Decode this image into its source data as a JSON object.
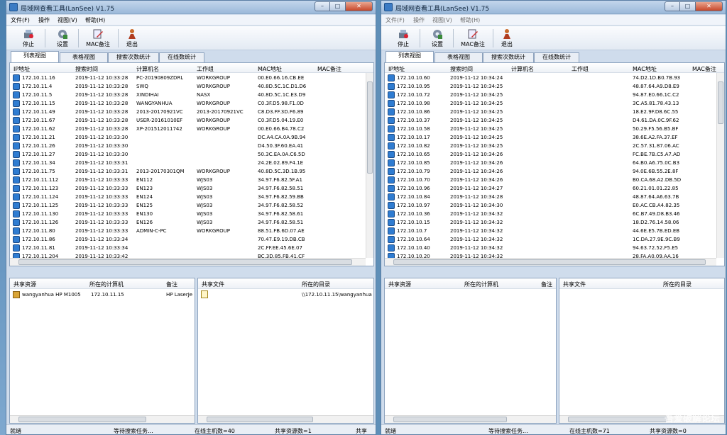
{
  "title": "局域网查看工具(LanSee) V1.75",
  "menu": [
    "文件(F)",
    "操作",
    "视图(V)",
    "帮助(H)"
  ],
  "window_buttons": {
    "min": "–",
    "max": "□",
    "close": "✕"
  },
  "toolbar": {
    "stop": "停止",
    "settings": "设置",
    "mac_note": "MAC备注",
    "exit": "退出"
  },
  "tabs": [
    "列表视图",
    "表格视图",
    "搜索次数统计",
    "在线数统计"
  ],
  "columns": [
    "IP地址",
    "搜索时间",
    "计算机名",
    "工作组",
    "MAC地址",
    "MAC备注"
  ],
  "left_rows": [
    [
      "172.10.11.16",
      "2019-11-12 10:33:28",
      "PC-20190809ZDRL",
      "WORKGROUP",
      "00.E0.66.16.CB.EE"
    ],
    [
      "172.10.11.4",
      "2019-11-12 10:33:28",
      "SWQ",
      "WORKGROUP",
      "40.8D.5C.1C.D1.D6"
    ],
    [
      "172.10.11.5",
      "2019-11-12 10:33:28",
      "XINDIHAI",
      "NASX",
      "40.8D.5C.1C.E3.D9"
    ],
    [
      "172.10.11.15",
      "2019-11-12 10:33:28",
      "WANGYANHUA",
      "WORKGROUP",
      "C0.3F.D5.98.F1.0D"
    ],
    [
      "172.10.11.49",
      "2019-11-12 10:33:28",
      "2013-20170921VC",
      "2013-20170921VC",
      "C8.D3.FF.3D.F6.89"
    ],
    [
      "172.10.11.67",
      "2019-11-12 10:33:28",
      "USER-20161010EF",
      "WORKGROUP",
      "C0.3F.D5.04.19.E0"
    ],
    [
      "172.10.11.62",
      "2019-11-12 10:33:28",
      "XP-201512011742",
      "WORKGROUP",
      "00.E0.66.B4.78.C2"
    ],
    [
      "172.10.11.21",
      "2019-11-12 10:33:30",
      "",
      "",
      "DC.A4.CA.0A.9B.94"
    ],
    [
      "172.10.11.26",
      "2019-11-12 10:33:30",
      "",
      "",
      "D4.50.3F.60.EA.41"
    ],
    [
      "172.10.11.27",
      "2019-11-12 10:33:30",
      "",
      "",
      "50.3C.EA.0A.C6.5D"
    ],
    [
      "172.10.11.34",
      "2019-11-12 10:33:31",
      "",
      "",
      "24.2E.02.89.F4.1E"
    ],
    [
      "172.10.11.75",
      "2019-11-12 10:33:31",
      "2013-20170301QM",
      "WORKGROUP",
      "40.8D.5C.3D.1B.95"
    ],
    [
      "172.10.11.112",
      "2019-11-12 10:33:33",
      "EN112",
      "WJS03",
      "34.97.F6.82.5F.A1"
    ],
    [
      "172.10.11.123",
      "2019-11-12 10:33:33",
      "EN123",
      "WJS03",
      "34.97.F6.82.58.51"
    ],
    [
      "172.10.11.124",
      "2019-11-12 10:33:33",
      "EN124",
      "WJS03",
      "34.97.F6.82.59.BB"
    ],
    [
      "172.10.11.125",
      "2019-11-12 10:33:33",
      "EN125",
      "WJS03",
      "34.97.F6.82.58.52"
    ],
    [
      "172.10.11.130",
      "2019-11-12 10:33:33",
      "EN130",
      "WJS03",
      "34.97.F6.82.58.61"
    ],
    [
      "172.10.11.126",
      "2019-11-12 10:33:33",
      "EN126",
      "WJS03",
      "34.97.F6.82.58.51"
    ],
    [
      "172.10.11.80",
      "2019-11-12 10:33:33",
      "ADMIN-C-PC",
      "WORKGROUP",
      "88.51.FB.6D.07.AE"
    ],
    [
      "172.10.11.86",
      "2019-11-12 10:33:34",
      "",
      "",
      "70.47.E9.19.DB.CB"
    ],
    [
      "172.10.11.81",
      "2019-11-12 10:33:34",
      "",
      "",
      "2C.FF.EE.45.6E.07"
    ],
    [
      "172.10.11.204",
      "2019-11-12 10:33:42",
      "",
      "",
      "BC.3D.85.FB.41.CF"
    ]
  ],
  "right_rows": [
    [
      "172.10.10.60",
      "2019-11-12 10:34:24",
      "",
      "",
      "74.D2.1D.B0.7B.93"
    ],
    [
      "172.10.10.95",
      "2019-11-12 10:34:25",
      "",
      "",
      "48.87.64.A9.D8.E9"
    ],
    [
      "172.10.10.72",
      "2019-11-12 10:34:25",
      "",
      "",
      "94.87.E0.66.1C.C2"
    ],
    [
      "172.10.10.98",
      "2019-11-12 10:34:25",
      "",
      "",
      "3C.A5.81.78.43.13"
    ],
    [
      "172.10.10.86",
      "2019-11-12 10:34:25",
      "",
      "",
      "18.E2.9F.D8.6C.55"
    ],
    [
      "172.10.10.37",
      "2019-11-12 10:34:25",
      "",
      "",
      "D4.61.DA.0C.9F.62"
    ],
    [
      "172.10.10.58",
      "2019-11-12 10:34:25",
      "",
      "",
      "50.29.F5.56.B5.BF"
    ],
    [
      "172.10.10.17",
      "2019-11-12 10:34:25",
      "",
      "",
      "38.6E.A2.FA.37.EF"
    ],
    [
      "172.10.10.82",
      "2019-11-12 10:34:25",
      "",
      "",
      "2C.57.31.87.06.AC"
    ],
    [
      "172.10.10.65",
      "2019-11-12 10:34:26",
      "",
      "",
      "FC.BE.7B.C5.A7.AD"
    ],
    [
      "172.10.10.85",
      "2019-11-12 10:34:26",
      "",
      "",
      "64.B0.A6.75.0C.B3"
    ],
    [
      "172.10.10.79",
      "2019-11-12 10:34:26",
      "",
      "",
      "94.0E.6B.55.2E.8F"
    ],
    [
      "172.10.10.70",
      "2019-11-12 10:34:26",
      "",
      "",
      "B0.CA.68.A2.DB.5D"
    ],
    [
      "172.10.10.96",
      "2019-11-12 10:34:27",
      "",
      "",
      "60.21.01.01.22.85"
    ],
    [
      "172.10.10.84",
      "2019-11-12 10:34:28",
      "",
      "",
      "48.87.64.A6.63.7B"
    ],
    [
      "172.10.10.97",
      "2019-11-12 10:34:30",
      "",
      "",
      "E0.AC.CB.A4.82.35"
    ],
    [
      "172.10.10.36",
      "2019-11-12 10:34:32",
      "",
      "",
      "6C.B7.49.D8.B3.46"
    ],
    [
      "172.10.10.15",
      "2019-11-12 10:34:32",
      "",
      "",
      "18.D2.76.14.58.06"
    ],
    [
      "172.10.10.7",
      "2019-11-12 10:34:32",
      "",
      "",
      "44.6E.E5.7B.ED.EB"
    ],
    [
      "172.10.10.64",
      "2019-11-12 10:34:32",
      "",
      "",
      "1C.DA.27.9E.9C.B9"
    ],
    [
      "172.10.10.40",
      "2019-11-12 10:34:32",
      "",
      "",
      "94.63.72.52.F5.E5"
    ],
    [
      "172.10.10.20",
      "2019-11-12 10:34:32",
      "",
      "",
      "28.FA.A0.09.AA.16"
    ]
  ],
  "shares_cols": [
    "共享资源",
    "所在的计算机",
    "备注"
  ],
  "files_cols": [
    "共享文件",
    "所在的目录"
  ],
  "left_share": [
    "wangyanhua HP M1005",
    "172.10.11.15",
    "HP LaserJe"
  ],
  "left_file": "\\\\172.10.11.15\\wangyanhua",
  "left_status": [
    "就绪",
    "等待搜索任务...",
    "在线主机数=40",
    "共享资源数=1",
    "共享"
  ],
  "right_status": [
    "就绪",
    "等待搜索任务...",
    "在线主机数=71",
    "共享资源数=0"
  ],
  "watermark": "吾爱破解论坛"
}
